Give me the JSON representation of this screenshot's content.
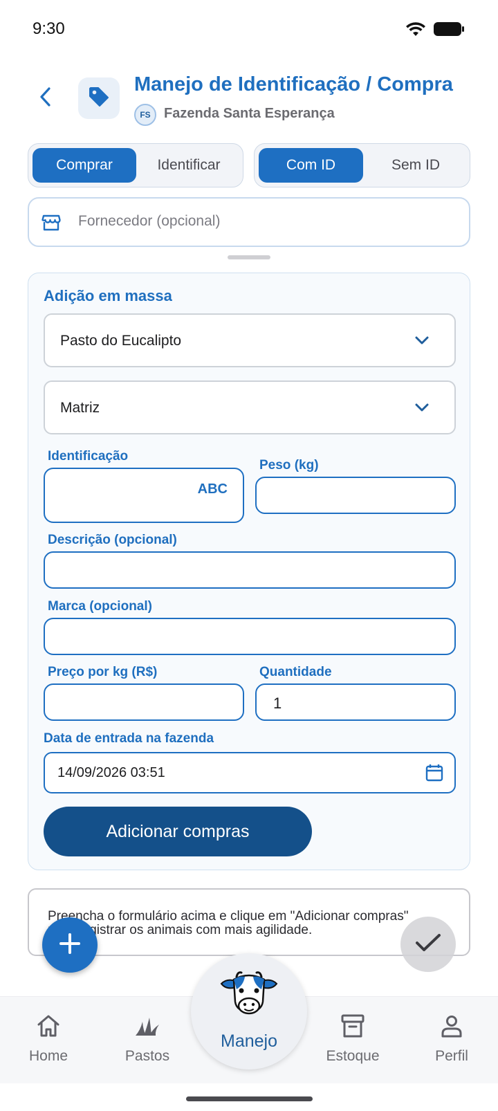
{
  "status_bar": {
    "time": "9:30"
  },
  "header": {
    "title": "Manejo de Identificação / Compra",
    "farm_initials": "FS",
    "farm_name": "Fazenda Santa Esperança"
  },
  "mode_toggle": {
    "options": [
      "Comprar",
      "Identificar"
    ],
    "selected": "Comprar"
  },
  "id_toggle": {
    "options": [
      "Com ID",
      "Sem ID"
    ],
    "selected": "Com ID"
  },
  "supplier": {
    "placeholder": "Fornecedor (opcional)",
    "value": ""
  },
  "bulk_add": {
    "title": "Adição em massa",
    "pasture_select": "Pasto do Eucalipto",
    "category_select": "Matriz",
    "identificacao": {
      "label": "Identificação",
      "value": "",
      "mode_tag": "ABC"
    },
    "peso": {
      "label": "Peso (kg)",
      "value": ""
    },
    "descricao": {
      "label": "Descrição (opcional)",
      "value": ""
    },
    "marca": {
      "label": "Marca (opcional)",
      "value": ""
    },
    "preco": {
      "label": "Preço por kg (R$)",
      "value": ""
    },
    "quantidade": {
      "label": "Quantidade",
      "value": "1"
    },
    "data_entrada": {
      "label": "Data de entrada na fazenda",
      "value": "14/09/2026 03:51"
    },
    "submit_label": "Adicionar compras"
  },
  "hint": {
    "text": "Preencha o formulário acima e clique em \"Adicionar compras\" para registrar os animais com mais agilidade."
  },
  "bottom_nav": {
    "items": [
      {
        "label": "Home",
        "icon": "home-icon"
      },
      {
        "label": "Pastos",
        "icon": "grass-icon"
      },
      {
        "label": "Manejo",
        "icon": "cow-icon"
      },
      {
        "label": "Estoque",
        "icon": "archive-icon"
      },
      {
        "label": "Perfil",
        "icon": "person-icon"
      }
    ],
    "active": "Manejo"
  },
  "colors": {
    "primary": "#1e6fc2",
    "primary_dark": "#14508a",
    "title_blue": "#1f6fbf",
    "muted_text": "#6b6b70"
  }
}
